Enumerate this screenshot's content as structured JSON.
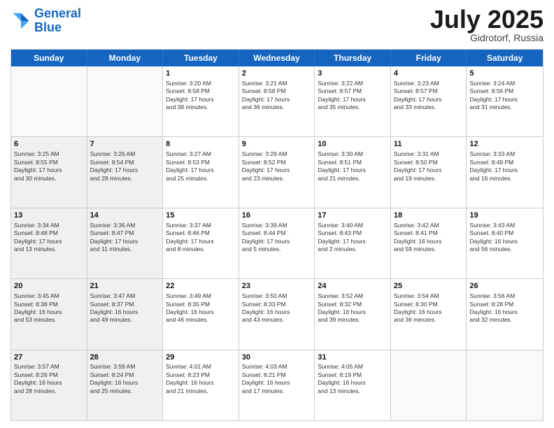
{
  "header": {
    "logo_line1": "General",
    "logo_line2": "Blue",
    "month_year": "July 2025",
    "location": "Gidrotorf, Russia"
  },
  "days_of_week": [
    "Sunday",
    "Monday",
    "Tuesday",
    "Wednesday",
    "Thursday",
    "Friday",
    "Saturday"
  ],
  "weeks": [
    [
      {
        "day": "",
        "sunrise": "",
        "sunset": "",
        "daylight": "",
        "shaded": true
      },
      {
        "day": "",
        "sunrise": "",
        "sunset": "",
        "daylight": "",
        "shaded": true
      },
      {
        "day": "1",
        "sunrise": "Sunrise: 3:20 AM",
        "sunset": "Sunset: 8:58 PM",
        "daylight": "Daylight: 17 hours and 38 minutes."
      },
      {
        "day": "2",
        "sunrise": "Sunrise: 3:21 AM",
        "sunset": "Sunset: 8:58 PM",
        "daylight": "Daylight: 17 hours and 36 minutes."
      },
      {
        "day": "3",
        "sunrise": "Sunrise: 3:22 AM",
        "sunset": "Sunset: 8:57 PM",
        "daylight": "Daylight: 17 hours and 35 minutes."
      },
      {
        "day": "4",
        "sunrise": "Sunrise: 3:23 AM",
        "sunset": "Sunset: 8:57 PM",
        "daylight": "Daylight: 17 hours and 33 minutes."
      },
      {
        "day": "5",
        "sunrise": "Sunrise: 3:24 AM",
        "sunset": "Sunset: 8:56 PM",
        "daylight": "Daylight: 17 hours and 31 minutes."
      }
    ],
    [
      {
        "day": "6",
        "sunrise": "Sunrise: 3:25 AM",
        "sunset": "Sunset: 8:55 PM",
        "daylight": "Daylight: 17 hours and 30 minutes.",
        "shaded": true
      },
      {
        "day": "7",
        "sunrise": "Sunrise: 3:26 AM",
        "sunset": "Sunset: 8:54 PM",
        "daylight": "Daylight: 17 hours and 28 minutes.",
        "shaded": true
      },
      {
        "day": "8",
        "sunrise": "Sunrise: 3:27 AM",
        "sunset": "Sunset: 8:53 PM",
        "daylight": "Daylight: 17 hours and 25 minutes."
      },
      {
        "day": "9",
        "sunrise": "Sunrise: 3:29 AM",
        "sunset": "Sunset: 8:52 PM",
        "daylight": "Daylight: 17 hours and 23 minutes."
      },
      {
        "day": "10",
        "sunrise": "Sunrise: 3:30 AM",
        "sunset": "Sunset: 8:51 PM",
        "daylight": "Daylight: 17 hours and 21 minutes."
      },
      {
        "day": "11",
        "sunrise": "Sunrise: 3:31 AM",
        "sunset": "Sunset: 8:50 PM",
        "daylight": "Daylight: 17 hours and 19 minutes."
      },
      {
        "day": "12",
        "sunrise": "Sunrise: 3:33 AM",
        "sunset": "Sunset: 8:49 PM",
        "daylight": "Daylight: 17 hours and 16 minutes."
      }
    ],
    [
      {
        "day": "13",
        "sunrise": "Sunrise: 3:34 AM",
        "sunset": "Sunset: 8:48 PM",
        "daylight": "Daylight: 17 hours and 13 minutes.",
        "shaded": true
      },
      {
        "day": "14",
        "sunrise": "Sunrise: 3:36 AM",
        "sunset": "Sunset: 8:47 PM",
        "daylight": "Daylight: 17 hours and 11 minutes.",
        "shaded": true
      },
      {
        "day": "15",
        "sunrise": "Sunrise: 3:37 AM",
        "sunset": "Sunset: 8:46 PM",
        "daylight": "Daylight: 17 hours and 8 minutes."
      },
      {
        "day": "16",
        "sunrise": "Sunrise: 3:39 AM",
        "sunset": "Sunset: 8:44 PM",
        "daylight": "Daylight: 17 hours and 5 minutes."
      },
      {
        "day": "17",
        "sunrise": "Sunrise: 3:40 AM",
        "sunset": "Sunset: 8:43 PM",
        "daylight": "Daylight: 17 hours and 2 minutes."
      },
      {
        "day": "18",
        "sunrise": "Sunrise: 3:42 AM",
        "sunset": "Sunset: 8:41 PM",
        "daylight": "Daylight: 16 hours and 59 minutes."
      },
      {
        "day": "19",
        "sunrise": "Sunrise: 3:43 AM",
        "sunset": "Sunset: 8:40 PM",
        "daylight": "Daylight: 16 hours and 56 minutes."
      }
    ],
    [
      {
        "day": "20",
        "sunrise": "Sunrise: 3:45 AM",
        "sunset": "Sunset: 8:38 PM",
        "daylight": "Daylight: 16 hours and 53 minutes.",
        "shaded": true
      },
      {
        "day": "21",
        "sunrise": "Sunrise: 3:47 AM",
        "sunset": "Sunset: 8:37 PM",
        "daylight": "Daylight: 16 hours and 49 minutes.",
        "shaded": true
      },
      {
        "day": "22",
        "sunrise": "Sunrise: 3:49 AM",
        "sunset": "Sunset: 8:35 PM",
        "daylight": "Daylight: 16 hours and 46 minutes."
      },
      {
        "day": "23",
        "sunrise": "Sunrise: 3:50 AM",
        "sunset": "Sunset: 8:33 PM",
        "daylight": "Daylight: 16 hours and 43 minutes."
      },
      {
        "day": "24",
        "sunrise": "Sunrise: 3:52 AM",
        "sunset": "Sunset: 8:32 PM",
        "daylight": "Daylight: 16 hours and 39 minutes."
      },
      {
        "day": "25",
        "sunrise": "Sunrise: 3:54 AM",
        "sunset": "Sunset: 8:30 PM",
        "daylight": "Daylight: 16 hours and 36 minutes."
      },
      {
        "day": "26",
        "sunrise": "Sunrise: 3:56 AM",
        "sunset": "Sunset: 8:28 PM",
        "daylight": "Daylight: 16 hours and 32 minutes."
      }
    ],
    [
      {
        "day": "27",
        "sunrise": "Sunrise: 3:57 AM",
        "sunset": "Sunset: 8:26 PM",
        "daylight": "Daylight: 16 hours and 28 minutes.",
        "shaded": true
      },
      {
        "day": "28",
        "sunrise": "Sunrise: 3:59 AM",
        "sunset": "Sunset: 8:24 PM",
        "daylight": "Daylight: 16 hours and 25 minutes.",
        "shaded": true
      },
      {
        "day": "29",
        "sunrise": "Sunrise: 4:01 AM",
        "sunset": "Sunset: 8:23 PM",
        "daylight": "Daylight: 16 hours and 21 minutes."
      },
      {
        "day": "30",
        "sunrise": "Sunrise: 4:03 AM",
        "sunset": "Sunset: 8:21 PM",
        "daylight": "Daylight: 16 hours and 17 minutes."
      },
      {
        "day": "31",
        "sunrise": "Sunrise: 4:05 AM",
        "sunset": "Sunset: 8:19 PM",
        "daylight": "Daylight: 16 hours and 13 minutes."
      },
      {
        "day": "",
        "sunrise": "",
        "sunset": "",
        "daylight": ""
      },
      {
        "day": "",
        "sunrise": "",
        "sunset": "",
        "daylight": ""
      }
    ]
  ]
}
